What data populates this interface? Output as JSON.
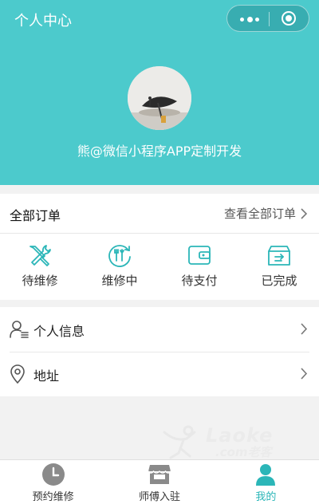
{
  "nav": {
    "title": "个人中心"
  },
  "profile": {
    "nickname": "熊@微信小程序APP定制开发"
  },
  "orders": {
    "title": "全部订单",
    "view_all": "查看全部订单",
    "statuses": [
      {
        "label": "待维修",
        "icon": "tools-icon"
      },
      {
        "label": "维修中",
        "icon": "repair-cycle-icon"
      },
      {
        "label": "待支付",
        "icon": "wallet-icon"
      },
      {
        "label": "已完成",
        "icon": "completed-box-icon"
      }
    ]
  },
  "menu": [
    {
      "label": "个人信息",
      "icon": "user-info-icon"
    },
    {
      "label": "地址",
      "icon": "location-pin-icon"
    }
  ],
  "watermark": {
    "logo": "Laoke",
    "sub": ".com老客"
  },
  "tabbar": [
    {
      "label": "预约维修",
      "icon": "clock-icon",
      "active": false
    },
    {
      "label": "师傅入驻",
      "icon": "shop-icon",
      "active": false
    },
    {
      "label": "我的",
      "icon": "person-icon",
      "active": true
    }
  ],
  "colors": {
    "accent": "#4ccacc",
    "active_tab": "#2bb6b8",
    "icon": "#2bb6b8"
  }
}
